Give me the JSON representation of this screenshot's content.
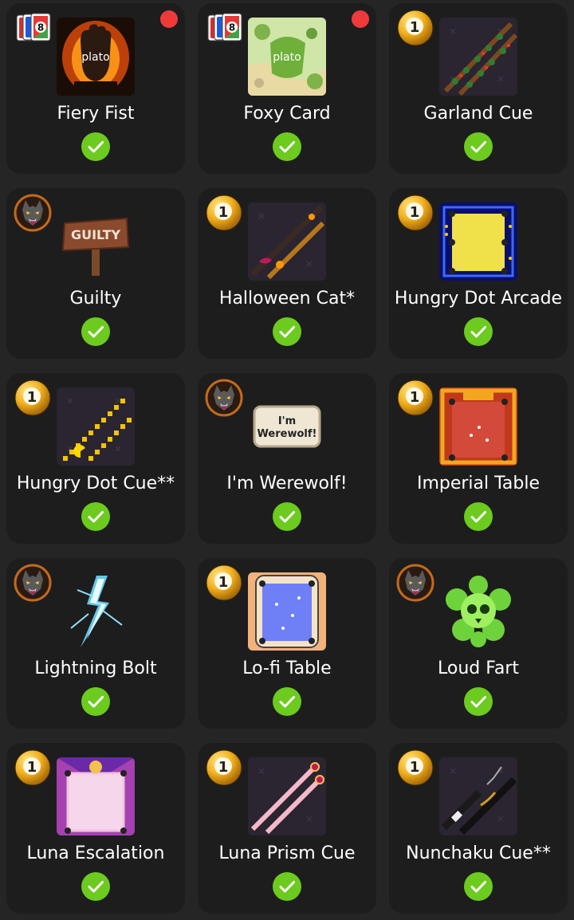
{
  "items": [
    {
      "title": "Fiery Fist",
      "badge": "uno-cards",
      "thumb": "fiery-fist",
      "thumb_text": "plato",
      "new": true,
      "owned": true
    },
    {
      "title": "Foxy Card",
      "badge": "uno-cards",
      "thumb": "foxy-card",
      "thumb_text": "plato",
      "new": true,
      "owned": true
    },
    {
      "title": "Garland Cue",
      "badge": "pool-ball-1",
      "thumb": "garland-cue",
      "new": false,
      "owned": true
    },
    {
      "title": "Guilty",
      "badge": "werewolf",
      "thumb": "guilty-sign",
      "thumb_text": "GUILTY",
      "new": false,
      "owned": true
    },
    {
      "title": "Halloween Cat*",
      "badge": "pool-ball-1",
      "thumb": "halloween-cue",
      "new": false,
      "owned": true
    },
    {
      "title": "Hungry Dot Arcade",
      "badge": "pool-ball-1",
      "thumb": "arcade-table",
      "new": false,
      "owned": true
    },
    {
      "title": "Hungry Dot Cue**",
      "badge": "pool-ball-1",
      "thumb": "pixel-cue",
      "new": false,
      "owned": true
    },
    {
      "title": "I'm Werewolf!",
      "badge": "werewolf",
      "thumb": "werewolf-sign",
      "thumb_text_1": "I'm",
      "thumb_text_2": "Werewolf!",
      "new": false,
      "owned": true
    },
    {
      "title": "Imperial Table",
      "badge": "pool-ball-1",
      "thumb": "imperial-table",
      "new": false,
      "owned": true
    },
    {
      "title": "Lightning Bolt",
      "badge": "werewolf",
      "thumb": "lightning",
      "new": false,
      "owned": true
    },
    {
      "title": "Lo-fi Table",
      "badge": "pool-ball-1",
      "thumb": "lofi-table",
      "new": false,
      "owned": true
    },
    {
      "title": "Loud Fart",
      "badge": "werewolf",
      "thumb": "green-skull",
      "new": false,
      "owned": true
    },
    {
      "title": "Luna Escalation",
      "badge": "pool-ball-1",
      "thumb": "luna-table",
      "new": false,
      "owned": true
    },
    {
      "title": "Luna Prism Cue",
      "badge": "pool-ball-1",
      "thumb": "luna-cue",
      "new": false,
      "owned": true
    },
    {
      "title": "Nunchaku Cue**",
      "badge": "pool-ball-1",
      "thumb": "nunchaku-cue",
      "new": false,
      "owned": true
    }
  ],
  "badge_texts": {
    "pool_ball_number": "1",
    "uno_card_number": "8"
  },
  "colors": {
    "background": "#252525",
    "card": "#1d1d1d",
    "check": "#6ccb1e",
    "new_dot": "#f03a3a",
    "ball": "#f2c33a"
  }
}
